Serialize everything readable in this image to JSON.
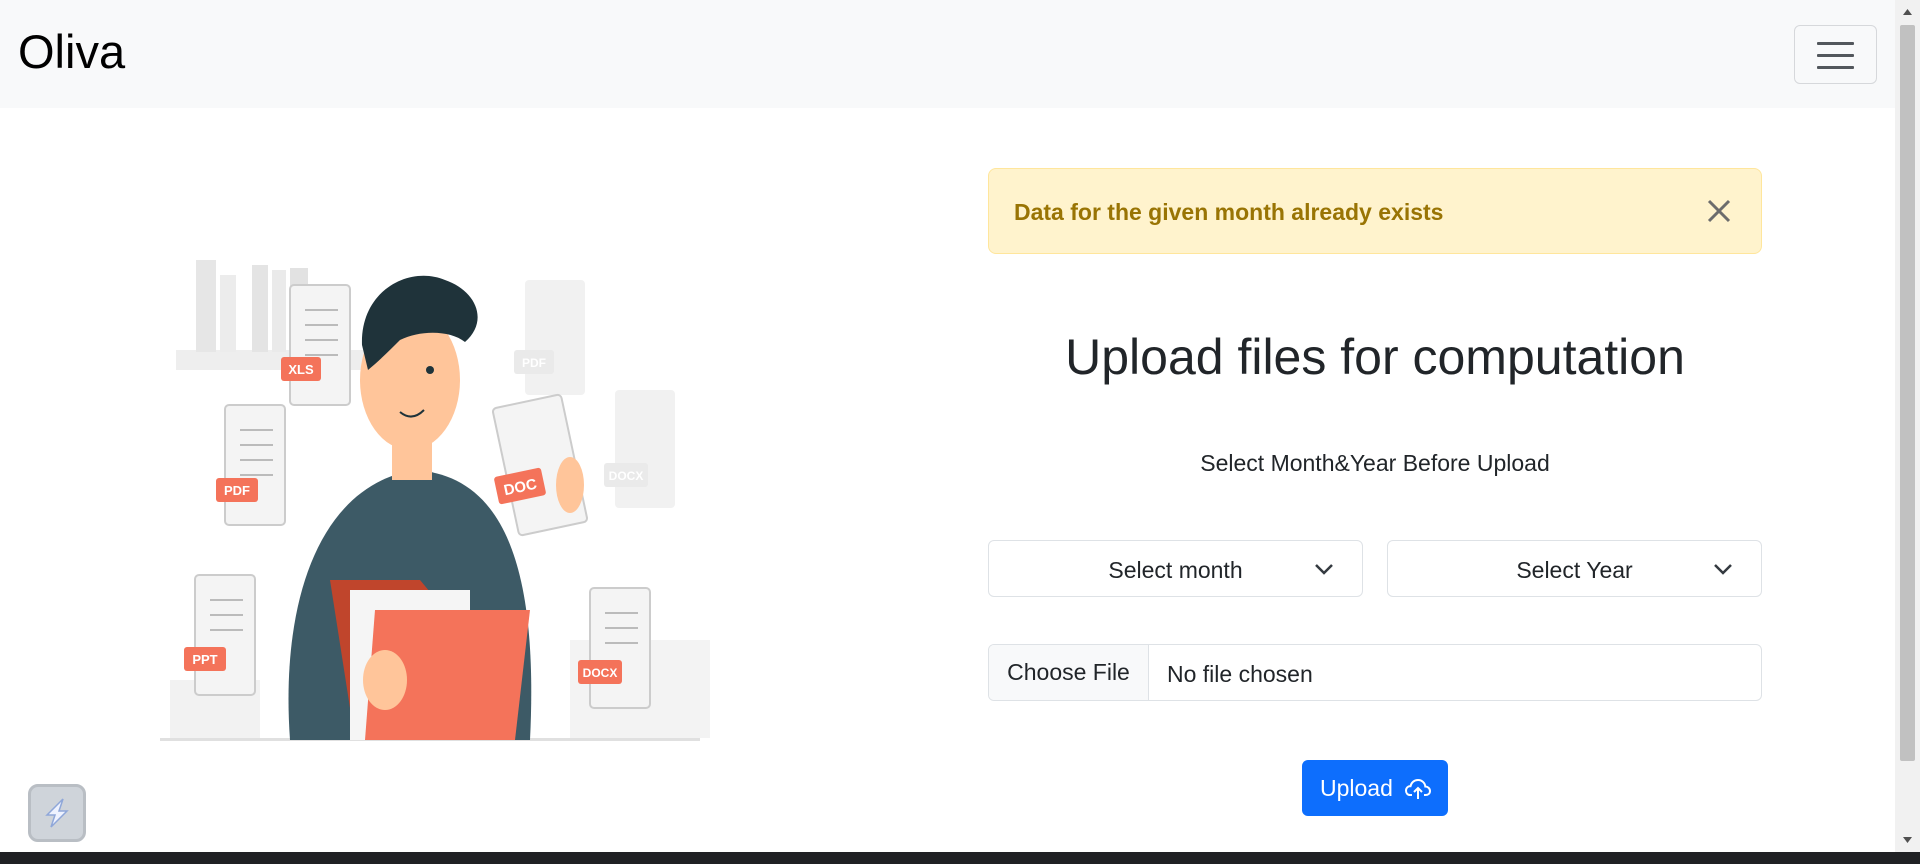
{
  "navbar": {
    "brand": "Oliva",
    "toggler_icon": "hamburger-menu-icon"
  },
  "illustration": {
    "doc_badges": [
      "XLS",
      "PDF",
      "PDF",
      "DOCX",
      "DOC",
      "PPT",
      "DOCX"
    ]
  },
  "alert": {
    "message": "Data for the given month already exists",
    "close_icon": "close-icon",
    "bg_color": "#fff3cd",
    "text_color": "#997404"
  },
  "main": {
    "title": "Upload files for computation",
    "subtitle": "Select Month&Year Before Upload"
  },
  "form": {
    "month_select": "Select month",
    "year_select": "Select Year",
    "file_button": "Choose File",
    "file_status": "No file chosen",
    "upload_button": "Upload",
    "upload_icon": "cloud-upload-icon",
    "accent_color": "#0d6efd"
  }
}
